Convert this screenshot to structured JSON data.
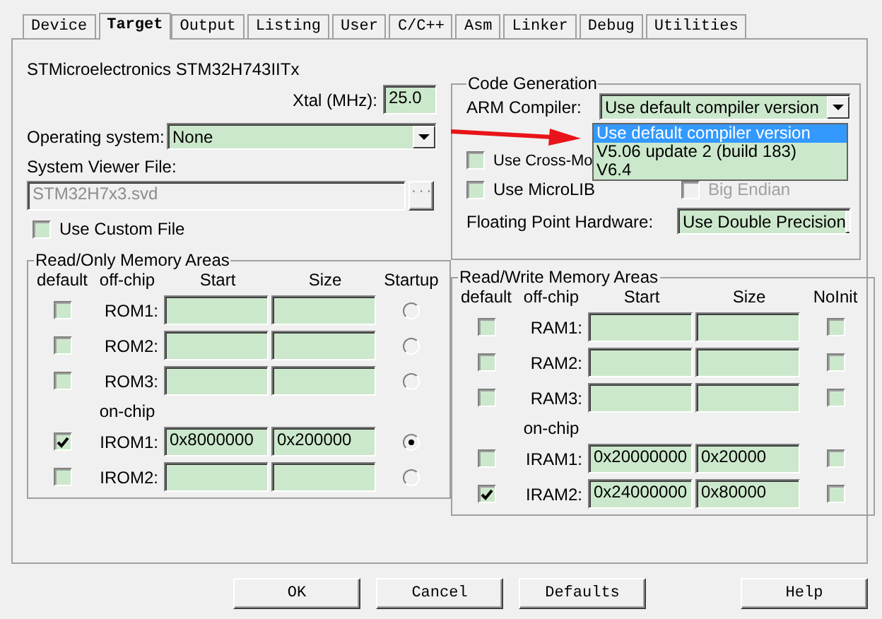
{
  "tabs": [
    {
      "label": "Device",
      "selected": false
    },
    {
      "label": "Target",
      "selected": true
    },
    {
      "label": "Output",
      "selected": false
    },
    {
      "label": "Listing",
      "selected": false
    },
    {
      "label": "User",
      "selected": false
    },
    {
      "label": "C/C++",
      "selected": false
    },
    {
      "label": "Asm",
      "selected": false
    },
    {
      "label": "Linker",
      "selected": false
    },
    {
      "label": "Debug",
      "selected": false
    },
    {
      "label": "Utilities",
      "selected": false
    }
  ],
  "device_name": "STMicroelectronics STM32H743IITx",
  "xtal": {
    "label": "Xtal (MHz):",
    "value": "25.0"
  },
  "operating_system": {
    "label": "Operating system:",
    "value": "None"
  },
  "system_viewer": {
    "label": "System Viewer File:",
    "value": "STM32H7x3.svd",
    "disabled": true,
    "browse": "..."
  },
  "use_custom_file": {
    "label": "Use Custom File",
    "checked": false
  },
  "code_generation": {
    "title": "Code Generation",
    "compiler_label": "ARM Compiler:",
    "compiler_value": "Use default compiler version",
    "compiler_options": [
      {
        "label": "Use default compiler version",
        "selected": true
      },
      {
        "label": "V5.06 update 2 (build 183)",
        "selected": false
      },
      {
        "label": "V6.4",
        "selected": false
      }
    ],
    "checkboxes": [
      {
        "label": "Use Cross-Mo",
        "checked": false,
        "disabled": false
      },
      {
        "label": "Use MicroLIB",
        "checked": false,
        "disabled": false
      },
      {
        "label": "Big Endian",
        "checked": false,
        "disabled": true
      }
    ],
    "fp_label": "Floating Point Hardware:",
    "fp_value": "Use Double Precision"
  },
  "read_only": {
    "title": "Read/Only Memory Areas",
    "columns": [
      "default",
      "off-chip",
      "Start",
      "Size",
      "Startup"
    ],
    "section_label": "on-chip",
    "rows": [
      {
        "default": false,
        "label": "ROM1:",
        "start": "",
        "size": "",
        "selected": false
      },
      {
        "default": false,
        "label": "ROM2:",
        "start": "",
        "size": "",
        "selected": false
      },
      {
        "default": false,
        "label": "ROM3:",
        "start": "",
        "size": "",
        "selected": false
      },
      {
        "default": true,
        "label": "IROM1:",
        "start": "0x8000000",
        "size": "0x200000",
        "selected": true
      },
      {
        "default": false,
        "label": "IROM2:",
        "start": "",
        "size": "",
        "selected": false
      }
    ]
  },
  "read_write": {
    "title": "Read/Write Memory Areas",
    "columns": [
      "default",
      "off-chip",
      "Start",
      "Size",
      "NoInit"
    ],
    "section_label": "on-chip",
    "rows": [
      {
        "default": false,
        "label": "RAM1:",
        "start": "",
        "size": "",
        "noinit": false
      },
      {
        "default": false,
        "label": "RAM2:",
        "start": "",
        "size": "",
        "noinit": false
      },
      {
        "default": false,
        "label": "RAM3:",
        "start": "",
        "size": "",
        "noinit": false
      },
      {
        "default": false,
        "label": "IRAM1:",
        "start": "0x20000000",
        "size": "0x20000",
        "noinit": false
      },
      {
        "default": true,
        "label": "IRAM2:",
        "start": "0x24000000",
        "size": "0x80000",
        "noinit": false
      }
    ]
  },
  "buttons": [
    "OK",
    "Cancel",
    "Defaults",
    "Help"
  ]
}
